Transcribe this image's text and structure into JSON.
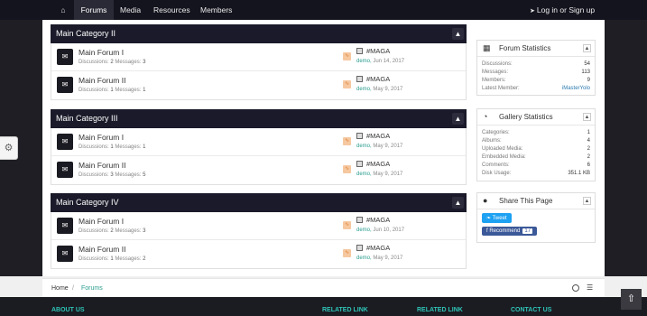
{
  "nav": {
    "items": [
      {
        "label": "Forums"
      },
      {
        "label": "Media"
      },
      {
        "label": "Resources"
      },
      {
        "label": "Members"
      }
    ],
    "login_label": "Log in or Sign up"
  },
  "categories": [
    {
      "title": "Main Category II",
      "forums": [
        {
          "title": "Main Forum I",
          "stats_prefix": "Discussions:",
          "discussions": "2",
          "messages_label": "Messages:",
          "messages": "3",
          "last_thread": "#MAGA",
          "last_user": "demo",
          "last_date": "Jun 14, 2017"
        },
        {
          "title": "Main Forum II",
          "stats_prefix": "Discussions:",
          "discussions": "1",
          "messages_label": "Messages:",
          "messages": "1",
          "last_thread": "#MAGA",
          "last_user": "demo",
          "last_date": "May 9, 2017"
        }
      ]
    },
    {
      "title": "Main Category III",
      "forums": [
        {
          "title": "Main Forum I",
          "stats_prefix": "Discussions:",
          "discussions": "1",
          "messages_label": "Messages:",
          "messages": "1",
          "last_thread": "#MAGA",
          "last_user": "demo",
          "last_date": "May 9, 2017"
        },
        {
          "title": "Main Forum II",
          "stats_prefix": "Discussions:",
          "discussions": "3",
          "messages_label": "Messages:",
          "messages": "5",
          "last_thread": "#MAGA",
          "last_user": "demo",
          "last_date": "May 9, 2017"
        }
      ]
    },
    {
      "title": "Main Category IV",
      "forums": [
        {
          "title": "Main Forum I",
          "stats_prefix": "Discussions:",
          "discussions": "2",
          "messages_label": "Messages:",
          "messages": "3",
          "last_thread": "#MAGA",
          "last_user": "demo",
          "last_date": "Jun 10, 2017"
        },
        {
          "title": "Main Forum II",
          "stats_prefix": "Discussions:",
          "discussions": "1",
          "messages_label": "Messages:",
          "messages": "2",
          "last_thread": "#MAGA",
          "last_user": "demo",
          "last_date": "May 9, 2017"
        }
      ]
    }
  ],
  "forum_stats": {
    "title": "Forum Statistics",
    "rows": [
      {
        "k": "Discussions:",
        "v": "54"
      },
      {
        "k": "Messages:",
        "v": "113"
      },
      {
        "k": "Members:",
        "v": "9"
      },
      {
        "k": "Latest Member:",
        "v": "iMasterYolo"
      }
    ]
  },
  "gallery_stats": {
    "title": "Gallery Statistics",
    "rows": [
      {
        "k": "Categories:",
        "v": "1"
      },
      {
        "k": "Albums:",
        "v": "4"
      },
      {
        "k": "Uploaded Media:",
        "v": "2"
      },
      {
        "k": "Embedded Media:",
        "v": "2"
      },
      {
        "k": "Comments:",
        "v": "6"
      },
      {
        "k": "Disk Usage:",
        "v": "351.1 KB"
      }
    ]
  },
  "share": {
    "title": "Share This Page",
    "tweet_label": "Tweet",
    "fb_label": "Recommend",
    "fb_count": "17"
  },
  "breadcrumb": {
    "home": "Home",
    "sep": "/",
    "current": "Forums"
  },
  "footer": {
    "headings": [
      "ABOUT US",
      "RELATED LINK",
      "RELATED LINK",
      "CONTACT US"
    ]
  },
  "colors": {
    "accent": "#2a9d8f",
    "nav_bg": "#14141f",
    "category_header": "#1a1a2a"
  }
}
